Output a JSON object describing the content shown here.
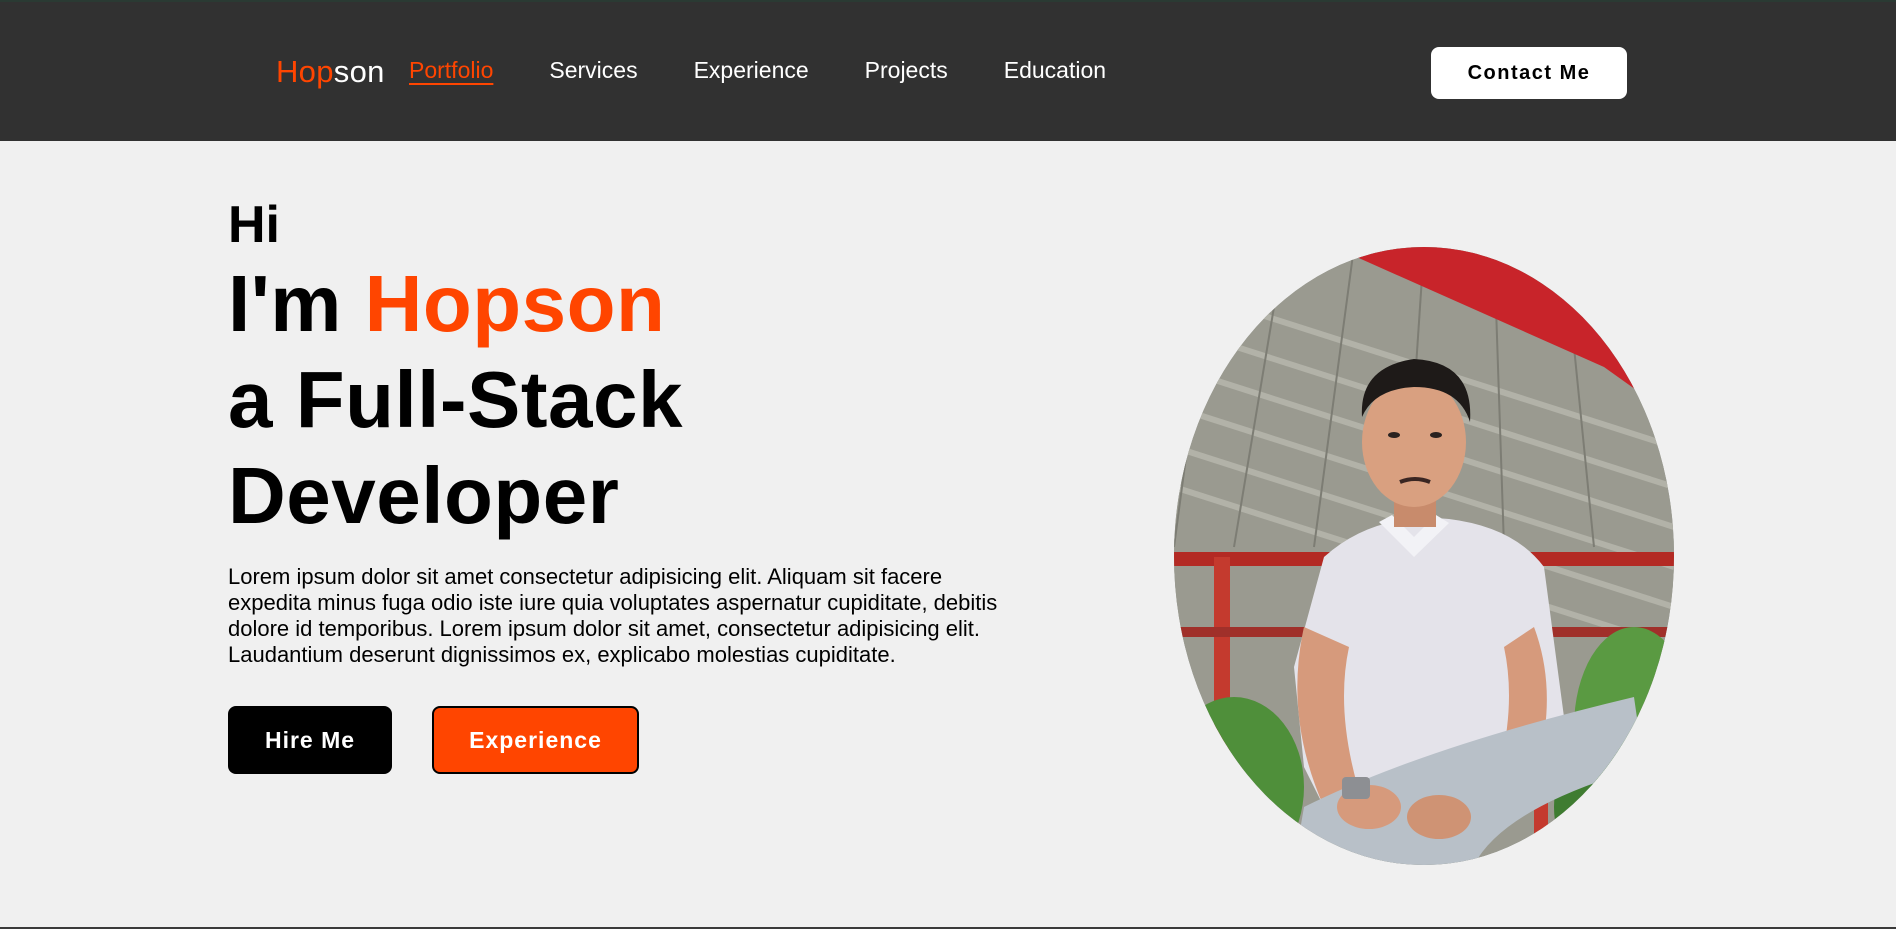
{
  "nav": {
    "logo_part1": "Hop",
    "logo_part2": "son",
    "links": [
      {
        "label": "Portfolio",
        "active": true
      },
      {
        "label": "Services"
      },
      {
        "label": "Experience"
      },
      {
        "label": "Projects"
      },
      {
        "label": "Education"
      }
    ],
    "contact_label": "Contact Me"
  },
  "hero": {
    "greeting": "Hi",
    "line1_prefix": "I'm ",
    "name": "Hopson",
    "line2": "a Full-Stack",
    "line3": "Developer",
    "description": "Lorem ipsum dolor sit amet consectetur adipisicing elit. Aliquam sit facere expedita minus fuga odio iste iure quia voluptates aspernatur cupiditate, debitis dolore id temporibus. Lorem ipsum dolor sit amet, consectetur adipisicing elit. Laudantium deserunt dignissimos ex, explicabo molestias cupiditate.",
    "hire_label": "Hire Me",
    "experience_label": "Experience"
  },
  "colors": {
    "accent": "#ff4500",
    "navbar_bg": "#313131",
    "page_bg": "#f0f0f0"
  }
}
